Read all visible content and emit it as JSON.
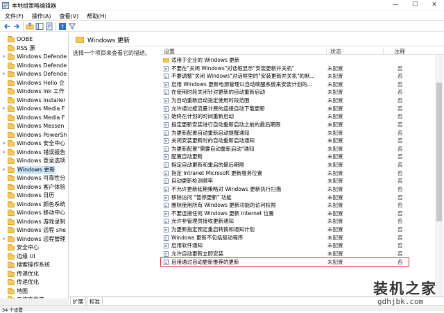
{
  "window": {
    "title": "本地组策略编辑器",
    "controls": [
      "—",
      "☐",
      "✕"
    ]
  },
  "menu": [
    "文件(F)",
    "操作(A)",
    "查看(V)",
    "帮助(H)"
  ],
  "toolbar": {
    "icons": [
      "back-arrow-icon",
      "forward-arrow-icon",
      "up-folder-icon",
      "show-tree-icon",
      "properties-icon",
      "help-icon",
      "filter-icon"
    ]
  },
  "tree": {
    "items": [
      {
        "label": "OOBE",
        "expand": ""
      },
      {
        "label": "RSS 源",
        "expand": ""
      },
      {
        "label": "Windows Defende",
        "expand": ">"
      },
      {
        "label": "Windows Defende",
        "expand": ""
      },
      {
        "label": "Windows Defende",
        "expand": ">"
      },
      {
        "label": "Windows Hello 企",
        "expand": ""
      },
      {
        "label": "Windows Ink 工作",
        "expand": ""
      },
      {
        "label": "Windows Installer",
        "expand": ""
      },
      {
        "label": "Windows Media F",
        "expand": ">"
      },
      {
        "label": "Windows Media F",
        "expand": ""
      },
      {
        "label": "Windows Messen",
        "expand": ""
      },
      {
        "label": "Windows PowerSh",
        "expand": ""
      },
      {
        "label": "Windows 安全中心",
        "expand": ">"
      },
      {
        "label": "Windows 错误报告",
        "expand": ">"
      },
      {
        "label": "Windows 登录选项",
        "expand": ""
      },
      {
        "label": "Windows 更新",
        "expand": ">",
        "selected": true
      },
      {
        "label": "Windows 可靠性分",
        "expand": ""
      },
      {
        "label": "Windows 客户体验",
        "expand": ""
      },
      {
        "label": "Windows 日历",
        "expand": ""
      },
      {
        "label": "Windows 颜色系统",
        "expand": ""
      },
      {
        "label": "Windows 移动中心",
        "expand": ""
      },
      {
        "label": "Windows 游戏录制",
        "expand": ""
      },
      {
        "label": "Windows 远程 she",
        "expand": ""
      },
      {
        "label": "Windows 远程管理",
        "expand": ">"
      },
      {
        "label": "安全中心",
        "expand": ""
      },
      {
        "label": "边缘 UI",
        "expand": ""
      },
      {
        "label": "搜索操作系统",
        "expand": ""
      },
      {
        "label": "传递优化",
        "expand": ""
      },
      {
        "label": "传递优化",
        "expand": ""
      },
      {
        "label": "地图",
        "expand": ""
      },
      {
        "label": "工作文件夹",
        "expand": ""
      }
    ]
  },
  "main": {
    "header": "Windows 更新",
    "description": "选择一个项目来查看它的描述。",
    "columns": {
      "setting": "设置",
      "status": "状态",
      "comment": "注释"
    },
    "rows": [
      {
        "name": "适用于企业的 Windows 更新",
        "status": "",
        "comment": "",
        "folder": true
      },
      {
        "name": "不要在\"关闭 Windows\"对话框显示\"安装更新并关机\"",
        "status": "未配置",
        "comment": "否"
      },
      {
        "name": "不要调整\"关闭 Windows\"对话框里的\"安装更新并关机\"的默...",
        "status": "未配置",
        "comment": "否"
      },
      {
        "name": "启用 Windows 更新电源管理以自动唤醒系统来安装计划的...",
        "status": "未配置",
        "comment": "否"
      },
      {
        "name": "在使用时段关闭针对更新的自动重新启动",
        "status": "未配置",
        "comment": "否"
      },
      {
        "name": "为自动重新启动指定使用时段范围",
        "status": "未配置",
        "comment": "否"
      },
      {
        "name": "允许通过按流量计费的连接自动下载更新",
        "status": "未配置",
        "comment": "否"
      },
      {
        "name": "始终在计划的时间重新启动",
        "status": "未配置",
        "comment": "否"
      },
      {
        "name": "指定更新安装进行自动重新启动之前的最后期限",
        "status": "未配置",
        "comment": "否"
      },
      {
        "name": "为更新配置自动重新启动提醒通知",
        "status": "未配置",
        "comment": "否"
      },
      {
        "name": "关闭安装更新时的自动重新启动通知",
        "status": "未配置",
        "comment": "否"
      },
      {
        "name": "为更新配置\"需要自动重新启动\"通知",
        "status": "未配置",
        "comment": "否"
      },
      {
        "name": "配置自动更新",
        "status": "未配置",
        "comment": "否"
      },
      {
        "name": "指定自动更新和重启的最后期限",
        "status": "未配置",
        "comment": "否"
      },
      {
        "name": "指定 Intranet Microsoft 更新服务位置",
        "status": "未配置",
        "comment": "否"
      },
      {
        "name": "自动更新检测频率",
        "status": "未配置",
        "comment": "否"
      },
      {
        "name": "不允许更新延期策略对 Windows 更新执行扫描",
        "status": "未配置",
        "comment": "否"
      },
      {
        "name": "移除访问 \"暂停更新\" 功能",
        "status": "未配置",
        "comment": "否"
      },
      {
        "name": "删除使用所有 Windows 更新功能的访问权限",
        "status": "未配置",
        "comment": "否"
      },
      {
        "name": "不要连接任何 Windows 更新 Internet 位置",
        "status": "未配置",
        "comment": "否"
      },
      {
        "name": "允许非管理员接收更新通知",
        "status": "未配置",
        "comment": "否"
      },
      {
        "name": "为更新指定预定重启转换和通知计划",
        "status": "未配置",
        "comment": "否"
      },
      {
        "name": "Windows 更新不包括驱动程序",
        "status": "未配置",
        "comment": "否",
        "highlighted": true
      },
      {
        "name": "启用软件通知",
        "status": "未配置",
        "comment": "否"
      },
      {
        "name": "允许自动更新立即安装",
        "status": "未配置",
        "comment": "否"
      },
      {
        "name": "启用通过自动更新推荐的更新",
        "status": "未配置",
        "comment": "否"
      }
    ],
    "tabs": [
      "扩展",
      "标准"
    ]
  },
  "status_bar": "34 个设置",
  "watermark": {
    "title": "装机之家",
    "url": "gdhjbk.com"
  },
  "colors": {
    "highlight_border": "#d2292c",
    "selection": "#cce8ff",
    "folder": "#f3c95b"
  }
}
